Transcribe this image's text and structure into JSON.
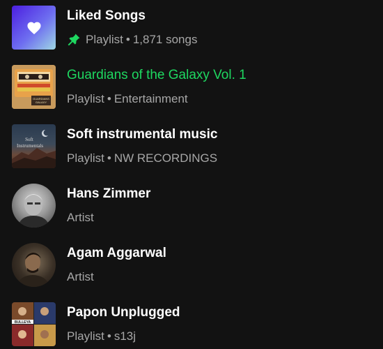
{
  "library": {
    "items": [
      {
        "title": "Liked Songs",
        "type": "Playlist",
        "detail": "1,871 songs",
        "pinned": true,
        "active": false,
        "thumb_icon": "heart-icon"
      },
      {
        "title": "Guardians of the Galaxy Vol. 1",
        "type": "Playlist",
        "detail": "Entertainment",
        "pinned": false,
        "active": true,
        "thumb_text": "GUARDIANS GALAXY"
      },
      {
        "title": "Soft instrumental music",
        "type": "Playlist",
        "detail": "NW RECORDINGS",
        "pinned": false,
        "active": false,
        "thumb_text": "Soft Instrumentals"
      },
      {
        "title": "Hans Zimmer",
        "type": "Artist",
        "detail": "",
        "pinned": false,
        "active": false
      },
      {
        "title": "Agam Aggarwal",
        "type": "Artist",
        "detail": "",
        "pinned": false,
        "active": false
      },
      {
        "title": "Papon Unplugged",
        "type": "Playlist",
        "detail": "s13j",
        "pinned": false,
        "active": false,
        "thumb_text": "BULLEYA"
      }
    ],
    "separator": "•"
  },
  "colors": {
    "background": "#121212",
    "title": "#ffffff",
    "subtitle": "#a7a7a7",
    "active": "#1ed760",
    "pin": "#1ed760"
  }
}
